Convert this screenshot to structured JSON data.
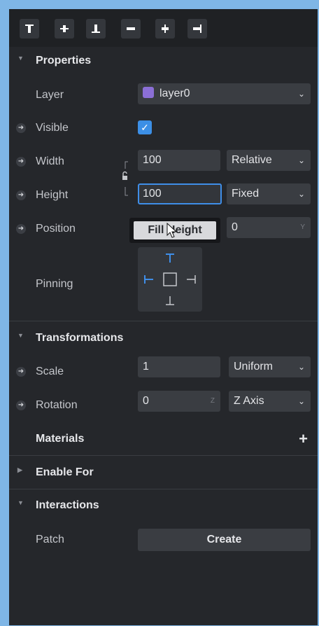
{
  "align_toolbar": {
    "icons": [
      "align-top-icon",
      "align-vertical-center-icon",
      "align-bottom-icon",
      "align-left-icon",
      "align-horizontal-center-icon",
      "align-right-icon"
    ]
  },
  "properties": {
    "title": "Properties",
    "layer": {
      "label": "Layer",
      "value": "layer0",
      "swatch_color": "#8b6fd6"
    },
    "visible": {
      "label": "Visible",
      "checked": true
    },
    "width": {
      "label": "Width",
      "value": "100",
      "mode": "Relative"
    },
    "height": {
      "label": "Height",
      "value": "100",
      "mode": "Fixed"
    },
    "position": {
      "label": "Position",
      "y_value": "0",
      "y_suffix": "Y"
    },
    "tooltip": {
      "label": "Fill Height"
    },
    "pinning": {
      "label": "Pinning"
    }
  },
  "transformations": {
    "title": "Transformations",
    "scale": {
      "label": "Scale",
      "value": "1",
      "mode": "Uniform"
    },
    "rotation": {
      "label": "Rotation",
      "value": "0",
      "suffix": "Z",
      "axis": "Z Axis"
    }
  },
  "materials": {
    "title": "Materials"
  },
  "enable_for": {
    "title": "Enable For"
  },
  "interactions": {
    "title": "Interactions",
    "patch": {
      "label": "Patch",
      "button": "Create"
    }
  },
  "colors": {
    "accent": "#3f8ee8",
    "panel": "#25272b",
    "frame": "#7fb6e6"
  }
}
